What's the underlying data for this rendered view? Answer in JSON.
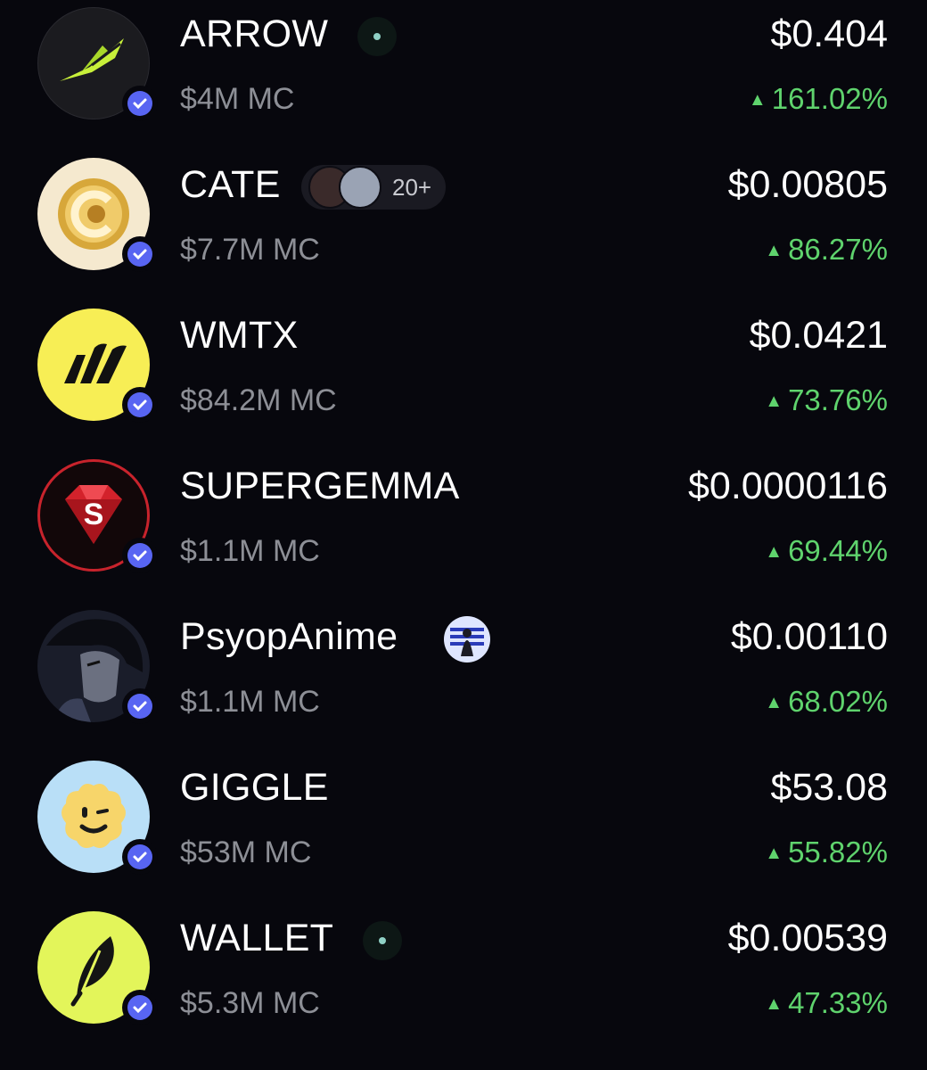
{
  "tokens": [
    {
      "symbol": "ARROW",
      "market_cap": "$4M MC",
      "price": "$0.404",
      "change": "161.02%",
      "verified": true,
      "icon": "arrow-feather-logo",
      "bg": "#1b1b1f"
    },
    {
      "symbol": "CATE",
      "market_cap": "$7.7M MC",
      "price": "$0.00805",
      "change": "86.27%",
      "verified": true,
      "icon": "cate-gold-coin-logo",
      "bg": "#f5e9cf",
      "holders_badge": "20+"
    },
    {
      "symbol": "WMTX",
      "market_cap": "$84.2M MC",
      "price": "$0.0421",
      "change": "73.76%",
      "verified": true,
      "icon": "wmtx-logo",
      "bg": "#f7ee55"
    },
    {
      "symbol": "SUPERGEMMA",
      "market_cap": "$1.1M MC",
      "price": "$0.0000116",
      "change": "69.44%",
      "verified": true,
      "icon": "super-gem-logo",
      "bg": "#120709"
    },
    {
      "symbol": "PsyopAnime",
      "market_cap": "$1.1M MC",
      "price": "$0.00110",
      "change": "68.02%",
      "verified": true,
      "icon": "anime-portrait-logo",
      "bg": "#1a1d2a"
    },
    {
      "symbol": "GIGGLE",
      "market_cap": "$53M MC",
      "price": "$53.08",
      "change": "55.82%",
      "verified": true,
      "icon": "giggle-smiley-logo",
      "bg": "#b9dff7"
    },
    {
      "symbol": "WALLET",
      "market_cap": "$5.3M MC",
      "price": "$0.00539",
      "change": "47.33%",
      "verified": true,
      "icon": "wallet-feather-logo",
      "bg": "#e3f55a"
    }
  ],
  "colors": {
    "up": "#5fd36d",
    "muted": "#8d8f96",
    "verify": "#5865f2",
    "background": "#07070d"
  }
}
